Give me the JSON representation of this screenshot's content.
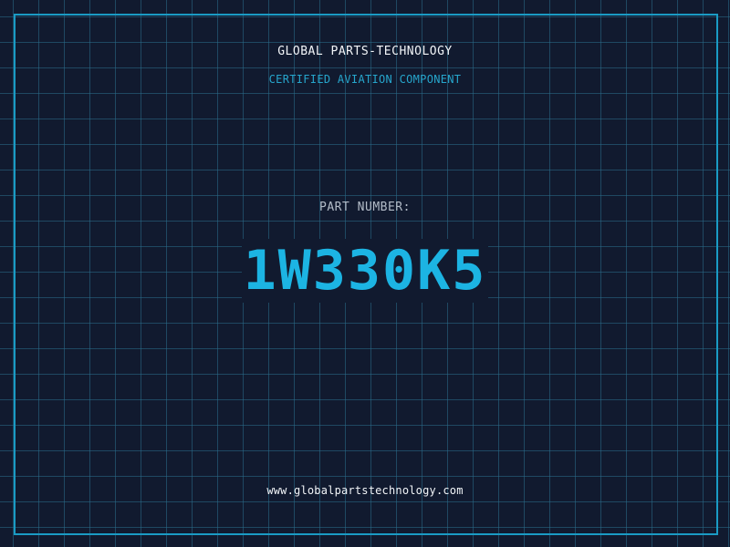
{
  "header": {
    "brand": "GLOBAL PARTS-TECHNOLOGY",
    "subtitle": "CERTIFIED AVIATION COMPONENT"
  },
  "part": {
    "label": "PART NUMBER:",
    "number": "1W330K5"
  },
  "footer": {
    "website": "www.globalpartstechnology.com"
  },
  "colors": {
    "background": "#111a2f",
    "grid": "#2a6e8c",
    "accent": "#1cb4e3",
    "frame": "#1a9bc4",
    "text": "#f2f5f8",
    "muted": "#b3bcc8"
  }
}
